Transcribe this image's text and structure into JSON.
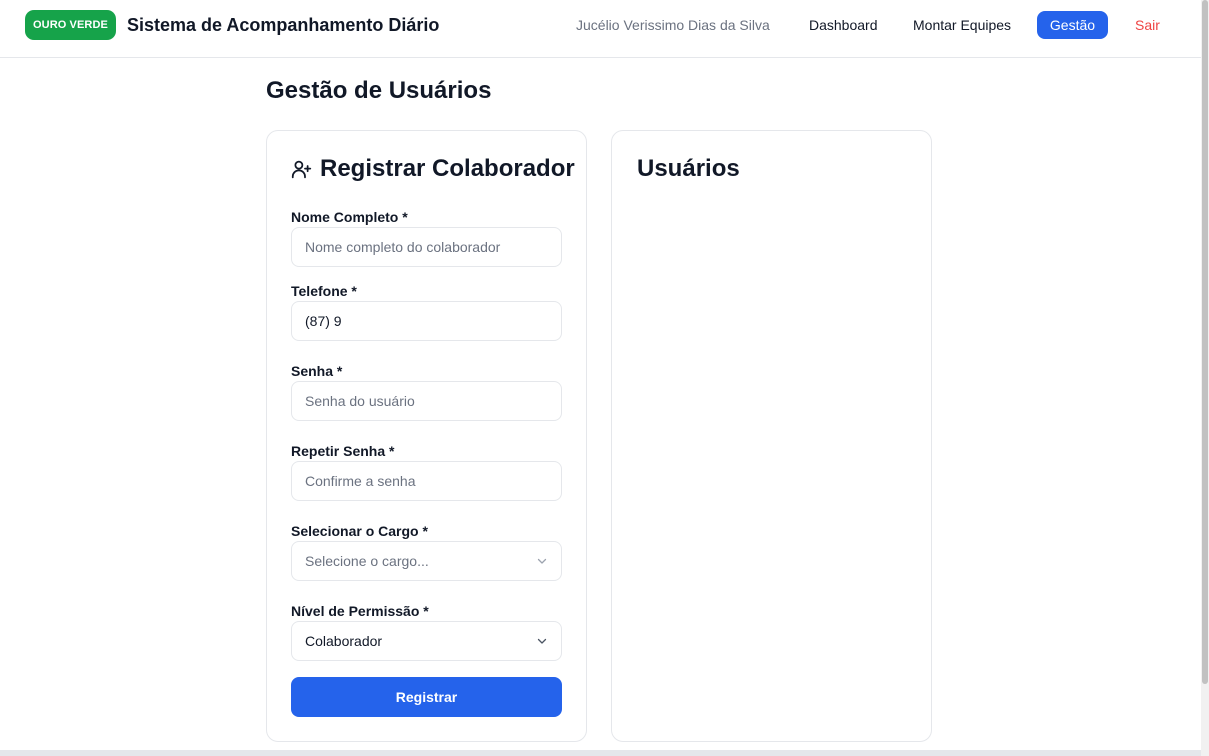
{
  "header": {
    "logo_text": "OURO VERDE",
    "app_title": "Sistema de Acompanhamento Diário",
    "user_name": "Jucélio Verissimo Dias da Silva",
    "nav": {
      "dashboard": "Dashboard",
      "montar_equipes": "Montar Equipes",
      "gestao": "Gestão",
      "sair": "Sair"
    }
  },
  "page": {
    "title": "Gestão de Usuários"
  },
  "register_form": {
    "heading": "Registrar Colaborador",
    "heading_icon": "user-plus-icon",
    "fields": {
      "nome": {
        "label": "Nome Completo *",
        "value": "",
        "placeholder": "Nome completo do colaborador"
      },
      "telefone": {
        "label": "Telefone *",
        "value": "(87) 9",
        "placeholder": ""
      },
      "senha": {
        "label": "Senha *",
        "value": "",
        "placeholder": "Senha do usuário"
      },
      "repetir_senha": {
        "label": "Repetir Senha *",
        "value": "",
        "placeholder": "Confirme a senha"
      },
      "cargo": {
        "label": "Selecionar o Cargo *",
        "selected": "Selecione o cargo..."
      },
      "permissao": {
        "label": "Nível de Permissão *",
        "selected": "Colaborador"
      }
    },
    "submit_label": "Registrar"
  },
  "users_panel": {
    "heading": "Usuários"
  },
  "colors": {
    "brand_green": "#16a34a",
    "primary_blue": "#2563eb",
    "danger_red": "#ef4444",
    "muted_text": "#6b7280",
    "border": "#e5e7eb"
  }
}
